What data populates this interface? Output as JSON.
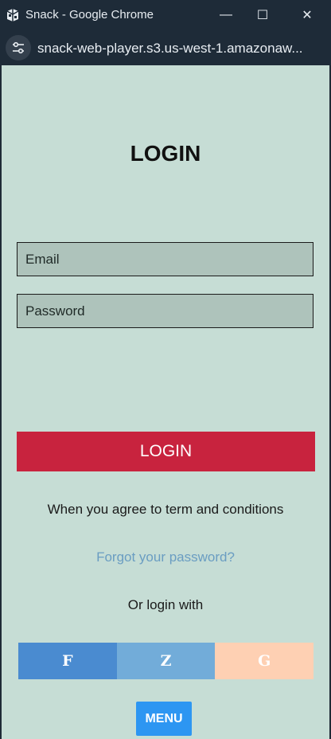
{
  "window": {
    "title": "Snack - Google Chrome",
    "minimize_glyph": "—",
    "maximize_glyph": "☐",
    "close_glyph": "✕"
  },
  "address_bar": {
    "url": "snack-web-player.s3.us-west-1.amazonaw..."
  },
  "login": {
    "heading": "LOGIN",
    "email_placeholder": "Email",
    "password_placeholder": "Password",
    "submit_label": "LOGIN",
    "terms_text": "When you agree to term and conditions",
    "forgot_link": "Forgot your password?",
    "alt_login_text": "Or login with"
  },
  "social": [
    {
      "label": "F",
      "color": "#4a8bd0"
    },
    {
      "label": "Z",
      "color": "#72acd9"
    },
    {
      "label": "G",
      "color": "#fed0b3"
    }
  ],
  "menu": {
    "label": "MENU"
  },
  "colors": {
    "page_bg": "#c6ddd5",
    "input_bg": "#aec3bb",
    "login_button": "#c8233e",
    "link": "#6a9dc2",
    "menu_button": "#2d96f2"
  }
}
